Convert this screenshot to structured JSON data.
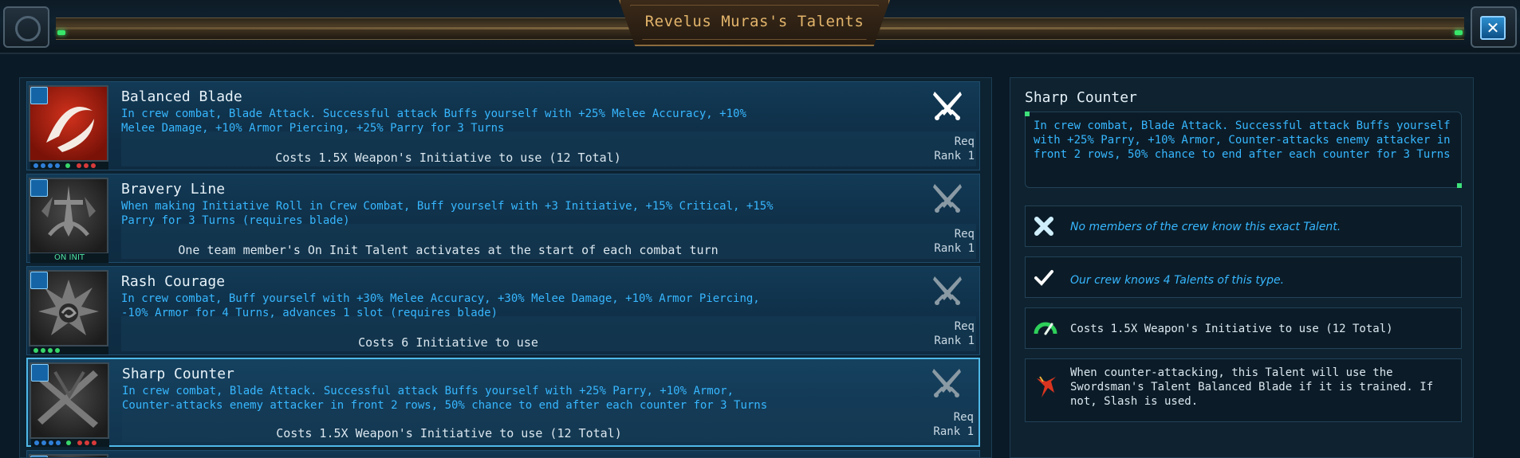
{
  "window": {
    "title": "Revelus Muras's Talents",
    "close_symbol": "✕"
  },
  "talents": [
    {
      "name": "Balanced Blade",
      "description": "In crew combat, Blade Attack. Successful attack Buffs yourself with +25% Melee Accuracy, +10% Melee Damage, +10% Armor Piercing, +25% Parry for 3 Turns",
      "cost": "Costs 1.5X Weapon's Initiative to use (12 Total)",
      "req": "Req",
      "rank": "Rank 1",
      "icon": "balanced-blade-icon",
      "state": "learned"
    },
    {
      "name": "Bravery Line",
      "description": "When making Initiative Roll in Crew Combat, Buff yourself with +3 Initiative, +15% Critical, +15% Parry for 3 Turns (requires blade)",
      "cost": "One team member's On Init Talent activates at the start of each combat turn",
      "req": "Req",
      "rank": "Rank 1",
      "icon": "bravery-line-icon",
      "badge": "ON INIT"
    },
    {
      "name": "Rash Courage",
      "description": "In crew combat, Buff yourself with +30% Melee Accuracy, +30% Melee Damage, +10% Armor Piercing, -10% Armor for 4 Turns, advances 1 slot (requires blade)",
      "cost": "Costs 6 Initiative to use",
      "req": "Req",
      "rank": "Rank 1",
      "icon": "rash-courage-icon"
    },
    {
      "name": "Sharp Counter",
      "description": "In crew combat, Blade Attack. Successful attack Buffs yourself with +25% Parry, +10% Armor, Counter-attacks enemy attacker in front 2 rows, 50% chance to end after each counter for 3 Turns",
      "cost": "Costs 1.5X Weapon's Initiative to use (12 Total)",
      "req": "Req",
      "rank": "Rank 1",
      "icon": "sharp-counter-icon",
      "state": "selected"
    }
  ],
  "detail": {
    "title": "Sharp Counter",
    "description": "In crew combat, Blade Attack. Successful attack Buffs yourself with +25% Parry, +10% Armor, Counter-attacks enemy attacker in front 2 rows, 50% chance to end after each counter for 3 Turns",
    "crew_unknown": "No members of the crew know this exact Talent.",
    "crew_knows": "Our crew knows 4 Talents of this type.",
    "cost": "Costs 1.5X Weapon's Initiative to use (12 Total)",
    "counter_note": "When counter-attacking, this Talent will use the Swordsman's Talent Balanced Blade if it is trained. If not, Slash is used."
  },
  "colors": {
    "accent_blue": "#37b7ff",
    "title_gold": "#e2b46b",
    "selected_border": "#4fb9e8",
    "status_green": "#3ee07a"
  }
}
